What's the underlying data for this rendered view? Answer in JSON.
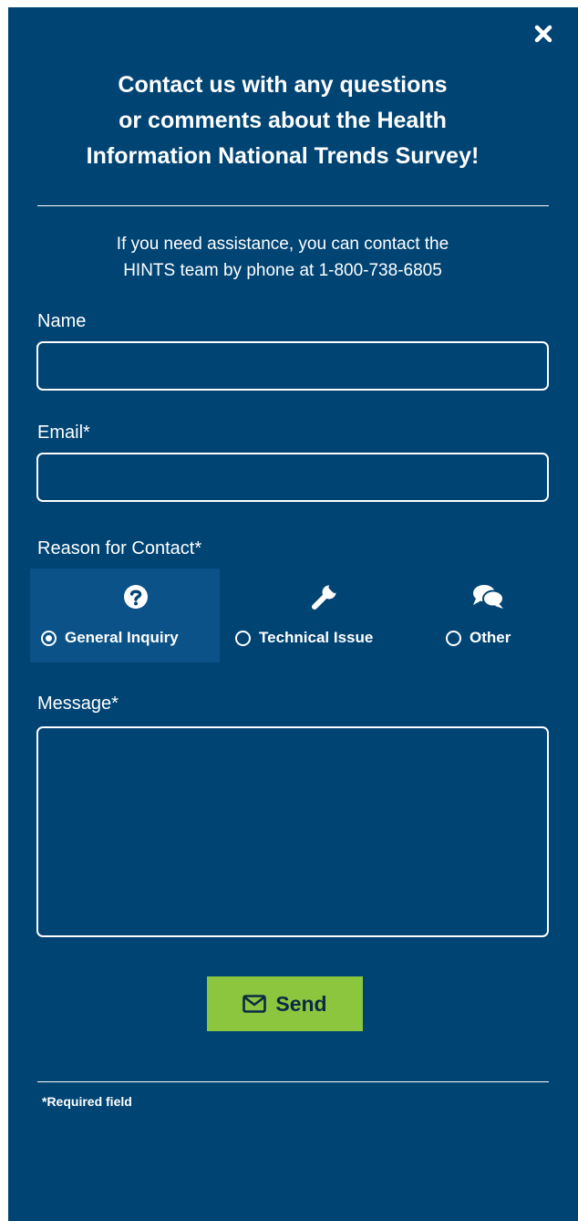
{
  "dialog": {
    "title_lines": [
      "Contact us with any questions",
      "or comments about the Health",
      "Information National Trends Survey!"
    ],
    "assist_lines": [
      "If you need assistance, you can contact the",
      "HINTS team by phone at 1-800-738-6805"
    ]
  },
  "form": {
    "name_label": "Name",
    "name_value": "",
    "email_label": "Email*",
    "email_value": "",
    "reason_label": "Reason for Contact*",
    "reasons": [
      {
        "label": "General Inquiry",
        "icon": "question-circle-icon",
        "selected": true
      },
      {
        "label": "Technical Issue",
        "icon": "wrench-icon",
        "selected": false
      },
      {
        "label": "Other",
        "icon": "comments-icon",
        "selected": false
      }
    ],
    "message_label": "Message*",
    "message_value": "",
    "send_label": "Send",
    "send_icon": "envelope-icon",
    "required_note": "*Required field"
  },
  "colors": {
    "panel_bg": "#004474",
    "selected_reason_bg": "#0a5287",
    "send_bg": "#8cc63f",
    "text": "#ffffff"
  }
}
